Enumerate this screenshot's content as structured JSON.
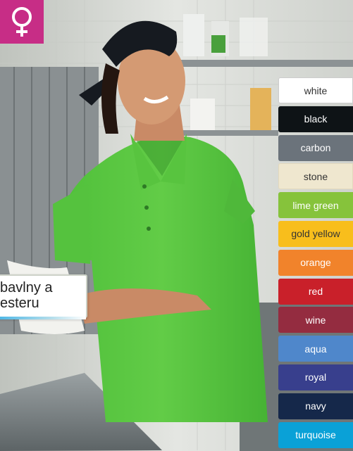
{
  "badge": {
    "icon": "female-icon",
    "color": "#c72d86"
  },
  "label_card": {
    "line1": "bavlny a",
    "line2": "esteru"
  },
  "swatches": [
    {
      "label": "white",
      "bg": "#ffffff",
      "fg": "#333333",
      "border": "#cccccc"
    },
    {
      "label": "black",
      "bg": "#0e1316",
      "fg": "#ffffff",
      "border": "#0e1316"
    },
    {
      "label": "carbon",
      "bg": "#6b737b",
      "fg": "#ffffff",
      "border": "#6b737b"
    },
    {
      "label": "stone",
      "bg": "#efe7cf",
      "fg": "#333333",
      "border": "#e3d9bd"
    },
    {
      "label": "lime green",
      "bg": "#86c33b",
      "fg": "#ffffff",
      "border": "#86c33b"
    },
    {
      "label": "gold yellow",
      "bg": "#f8be1c",
      "fg": "#333333",
      "border": "#f8be1c"
    },
    {
      "label": "orange",
      "bg": "#f1832b",
      "fg": "#ffffff",
      "border": "#f1832b"
    },
    {
      "label": "red",
      "bg": "#c9202a",
      "fg": "#ffffff",
      "border": "#c9202a"
    },
    {
      "label": "wine",
      "bg": "#942c40",
      "fg": "#ffffff",
      "border": "#942c40"
    },
    {
      "label": "aqua",
      "bg": "#4f87cb",
      "fg": "#ffffff",
      "border": "#4f87cb"
    },
    {
      "label": "royal",
      "bg": "#383f8d",
      "fg": "#ffffff",
      "border": "#383f8d"
    },
    {
      "label": "navy",
      "bg": "#15284a",
      "fg": "#ffffff",
      "border": "#15284a"
    },
    {
      "label": "turquoise",
      "bg": "#0aa1d7",
      "fg": "#ffffff",
      "border": "#0aa1d7"
    }
  ]
}
